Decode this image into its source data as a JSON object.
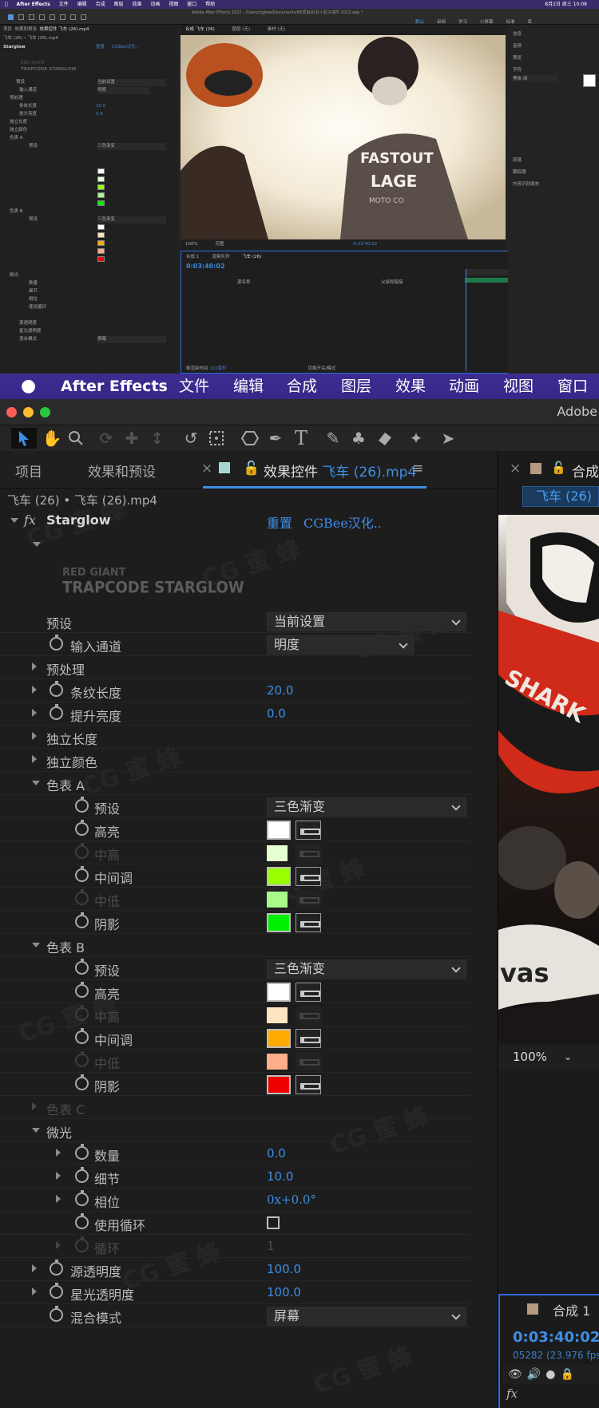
{
  "mini": {
    "menu": [
      "After Effects",
      "文件",
      "编辑",
      "合成",
      "图层",
      "效果",
      "动画",
      "视图",
      "窗口",
      "帮助"
    ],
    "title": "Adobe After Effects 2022 - /Users/cgbee/Documents/AE项目/红巨人粒子插件 2023.aep *",
    "status": "8月2日 周三 10:08",
    "tabs": [
      "项目",
      "效果和预设",
      "效果控件 飞车 (26).mp4",
      "合成 飞车 (26)",
      "图层 (无)",
      "素材 (无)"
    ],
    "workspaces": [
      "默认",
      "审阅",
      "学习",
      "小屏幕",
      "标准",
      "库"
    ],
    "right_panel": [
      "信息",
      "音频",
      "预览",
      "字符",
      "段落",
      "跟踪器",
      "内容识别填充"
    ],
    "font_name": "黑体-简",
    "viewer_zoom": "100%",
    "viewer_quality": "完整",
    "viewer_time": "0:03:40:02",
    "timeline_tabs": [
      "合成 1",
      "渲染队列",
      "飞车 (26)"
    ],
    "timeline_time": "0:03:40:02",
    "timeline_cols": [
      "源名称",
      "父级和链接"
    ],
    "timeline_footer": [
      "帧渲染时间",
      "110毫秒",
      "切换开关/模式"
    ],
    "rider_text": [
      "FASTOUT",
      "LAGE",
      "MOTO CO"
    ]
  },
  "menubar": {
    "app": "After Effects",
    "items": [
      "文件",
      "编辑",
      "合成",
      "图层",
      "效果",
      "动画",
      "视图",
      "窗口"
    ]
  },
  "titlebar": {
    "title": "Adobe"
  },
  "panel_tabs": {
    "project": "项目",
    "effects_presets": "效果和预设",
    "effect_controls": "效果控件",
    "layer_name": "飞车 (26).mp4"
  },
  "breadcrumb": "飞车 (26) • 飞车 (26).mp4",
  "effect": {
    "fx": "fx",
    "name": "Starglow",
    "reset": "重置",
    "credit": "CGBee汉化..",
    "logo_line1": "RED GIANT",
    "logo_line2": "TRAPCODE STARGLOW"
  },
  "rows": {
    "preset_label": "预设",
    "preset_value": "当前设置",
    "input_channel_label": "输入通道",
    "input_channel_value": "明度",
    "preprocess": "预处理",
    "streak_length_label": "条纹长度",
    "streak_length_value": "20.0",
    "boost_light_label": "提升亮度",
    "boost_light_value": "0.0",
    "individual_lengths": "独立长度",
    "individual_colors": "独立颜色",
    "colormap_a": "色表 A",
    "colormap_b": "色表 B",
    "colormap_c": "色表 C",
    "cm_preset": "预设",
    "cm_preset_value": "三色渐变",
    "highlights": "高亮",
    "mid_high": "中高",
    "midtones": "中间调",
    "mid_low": "中低",
    "shadows": "阴影",
    "shimmer": "微光",
    "amount_label": "数量",
    "amount_value": "0.0",
    "detail_label": "细节",
    "detail_value": "10.0",
    "phase_label": "相位",
    "phase_value": "0x+0.0°",
    "use_loop_label": "使用循环",
    "revolutions_label": "循环",
    "revolutions_value": "1",
    "source_opacity_label": "源透明度",
    "source_opacity_value": "100.0",
    "starglow_opacity_label": "星光透明度",
    "starglow_opacity_value": "100.0",
    "transfer_mode_label": "混合模式",
    "transfer_mode_value": "屏幕"
  },
  "colors": {
    "a_highlights": "#ffffff",
    "a_mid_high": "#e4ffd0",
    "a_midtones": "#99ff00",
    "a_mid_low": "#a8f88a",
    "a_shadows": "#00ee00",
    "b_highlights": "#ffffff",
    "b_mid_high": "#ffe4c0",
    "b_midtones": "#ffaa00",
    "b_mid_low": "#ffae8a",
    "b_shadows": "#ee0000",
    "accent_blue": "#3d8ee6",
    "menubar_purple": "#3b2b8c"
  },
  "right": {
    "comp_tab": "合成",
    "comp_name_tab": "飞车 (26)",
    "zoom": "100%",
    "timeline_tab": "合成 1",
    "timecode": "0:03:40:02",
    "frames": "05282 (23.976 fps",
    "fx": "fx",
    "video_text": [
      "SHARK",
      "vas"
    ]
  },
  "watermark": "CG 蜜 蜂"
}
